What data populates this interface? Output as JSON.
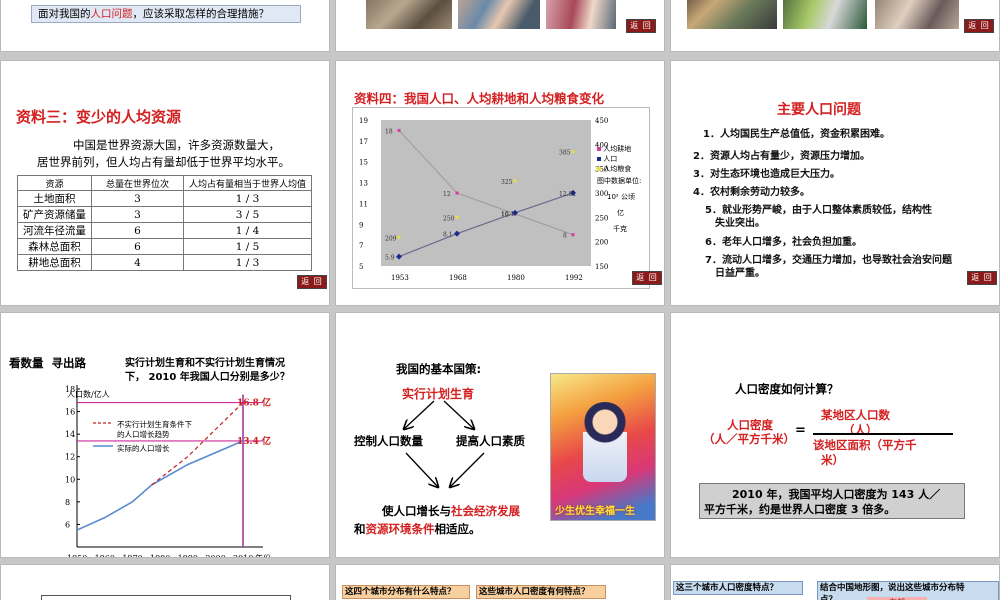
{
  "slide1": {
    "question": "面对我国的人口问题，应该采取怎样的合理措施？",
    "question_pre": "面对我国的",
    "question_hl": "人口问题",
    "question_post": "，应该采取怎样的合理措施？"
  },
  "back_label": "返 回",
  "slide4": {
    "title": "资料三：变少的人均资源",
    "intro1": "中国是世界资源大国，许多资源数量大，",
    "intro2": "居世界前列，但人均占有量却低于世界平均水平。",
    "table": {
      "headers": [
        "资源",
        "总量在世界位次",
        "人均占有量相当于世界人均值"
      ],
      "rows": [
        [
          "土地面积",
          "3",
          "1 / 3"
        ],
        [
          "矿产资源储量",
          "3",
          "3 / 5"
        ],
        [
          "河流年径流量",
          "6",
          "1 / 4"
        ],
        [
          "森林总面积",
          "6",
          "1 / 5"
        ],
        [
          "耕地总面积",
          "4",
          "1 / 3"
        ]
      ]
    }
  },
  "slide5": {
    "title": "资料四：我国人口、人均耕地和人均粮食变化",
    "left_ticks": [
      "19",
      "17",
      "15",
      "13",
      "11",
      "9",
      "7",
      "5"
    ],
    "right_ticks": [
      "450",
      "400",
      "350",
      "300",
      "250",
      "200",
      "150"
    ],
    "x_ticks": [
      "1953",
      "1968",
      "1980",
      "1992"
    ],
    "legend": {
      "items": [
        "人均耕地",
        "人口",
        "人均粮食"
      ],
      "note1": "图中数据单位:",
      "note2": "10² 公顷",
      "note3": "亿",
      "note4": "千克"
    },
    "chart_data": {
      "type": "line",
      "x": [
        "1953",
        "1968",
        "1980",
        "1992"
      ],
      "series": [
        {
          "name": "人均耕地",
          "values": [
            18,
            12,
            10,
            8
          ],
          "axis": "left",
          "color": "#d63aa0"
        },
        {
          "name": "人口",
          "values": [
            5.9,
            8.1,
            10.1,
            12.01
          ],
          "axis": "left",
          "color": "#1a2a8f"
        },
        {
          "name": "人均粮食",
          "values": [
            209,
            250,
            325,
            385
          ],
          "axis": "right",
          "color": "#e6e23a"
        }
      ],
      "labels": {
        "人均耕地": [
          "18",
          "12",
          "10",
          "8"
        ],
        "人口": [
          "5.9",
          "8.1",
          "10.1",
          "12.01"
        ],
        "人均粮食": [
          "209",
          "250",
          "325",
          "385"
        ]
      },
      "ylim_left": [
        5,
        19
      ],
      "ylim_right": [
        150,
        450
      ],
      "grid": false
    }
  },
  "slide6": {
    "title": "主要人口问题",
    "items": [
      "1．人均国民生产总值低，资金积累困难。",
      "2．资源人均占有量少，资源压力增加。",
      "3．对生态环境也造成巨大压力。",
      "4．农村剩余劳动力较多。",
      "5．就业形势严峻，由于人口整体素质较低，结构性",
      "失业突出。",
      "6．老年人口增多，社会负担加重。",
      "7．流动人口增多，交通压力增加，也导致社会治安问题",
      "日益严重。"
    ]
  },
  "slide7": {
    "heading": "看数量  寻出路",
    "question1": "实行计划生育和不实行计划生育情况",
    "question2": "下， 2010 年我国人口分别是多少？",
    "ylabel": "人口数/亿人",
    "yticks": [
      "18",
      "16",
      "14",
      "12",
      "10",
      "8",
      "6"
    ],
    "xticks": [
      "1950",
      "1960",
      "1970",
      "1980",
      "1990",
      "2000",
      "2010"
    ],
    "xunit": "年份",
    "legend_dash1": "不实行计划生育条件下",
    "legend_dash2": "的人口增长趋势",
    "legend_solid": "实际的人口增长",
    "val_high": "16.8 亿",
    "val_low": "13.4 亿",
    "chart_data": {
      "type": "line",
      "xlabel": "年份",
      "ylabel": "人口数/亿人",
      "ylim": [
        4,
        18
      ],
      "series": [
        {
          "name": "实际的人口增长",
          "x": [
            1950,
            1960,
            1970,
            1977,
            1990,
            2010
          ],
          "values": [
            5.5,
            6.6,
            8.0,
            9.5,
            11.3,
            13.4
          ]
        },
        {
          "name": "不实行计划生育条件下的人口增长趋势",
          "x": [
            1977,
            1990,
            2010
          ],
          "values": [
            9.5,
            12.0,
            16.8
          ]
        }
      ]
    }
  },
  "slide8": {
    "label": "我国的基本国策:",
    "policy": "实行计划生育",
    "left": "控制人口数量",
    "right": "提高人口素质",
    "bottom1_pre": "使人口增长与",
    "bottom1_hl": "社会经济发展",
    "bottom2_pre": "和",
    "bottom2_hl": "资源环境条件",
    "bottom2_post": "相适应。",
    "poster_text": "少生优生幸福一生"
  },
  "slide9": {
    "question": "人口密度如何计算？",
    "lhs1": "人口密度",
    "lhs2": "（人／平方千米）",
    "eq": "=",
    "num1": "某地区人口数",
    "num2": "（人）",
    "den1": "该地区面积（平方千",
    "den2": "米）",
    "fact1": "2010 年，我国平均人口密度为 143 人／",
    "fact2": "平方千米，约是世界人口密度 3 倍多。"
  },
  "slide11": {
    "q1": "这四个城市分布有什么特点？",
    "q2": "这些城市人口密度有何特点？"
  },
  "slide12": {
    "q1": "这三个城市人口密度特点？",
    "q2": "结合中国地形图，说出这些城市分布特",
    "q2b": "点？",
    "partial": "东部"
  }
}
